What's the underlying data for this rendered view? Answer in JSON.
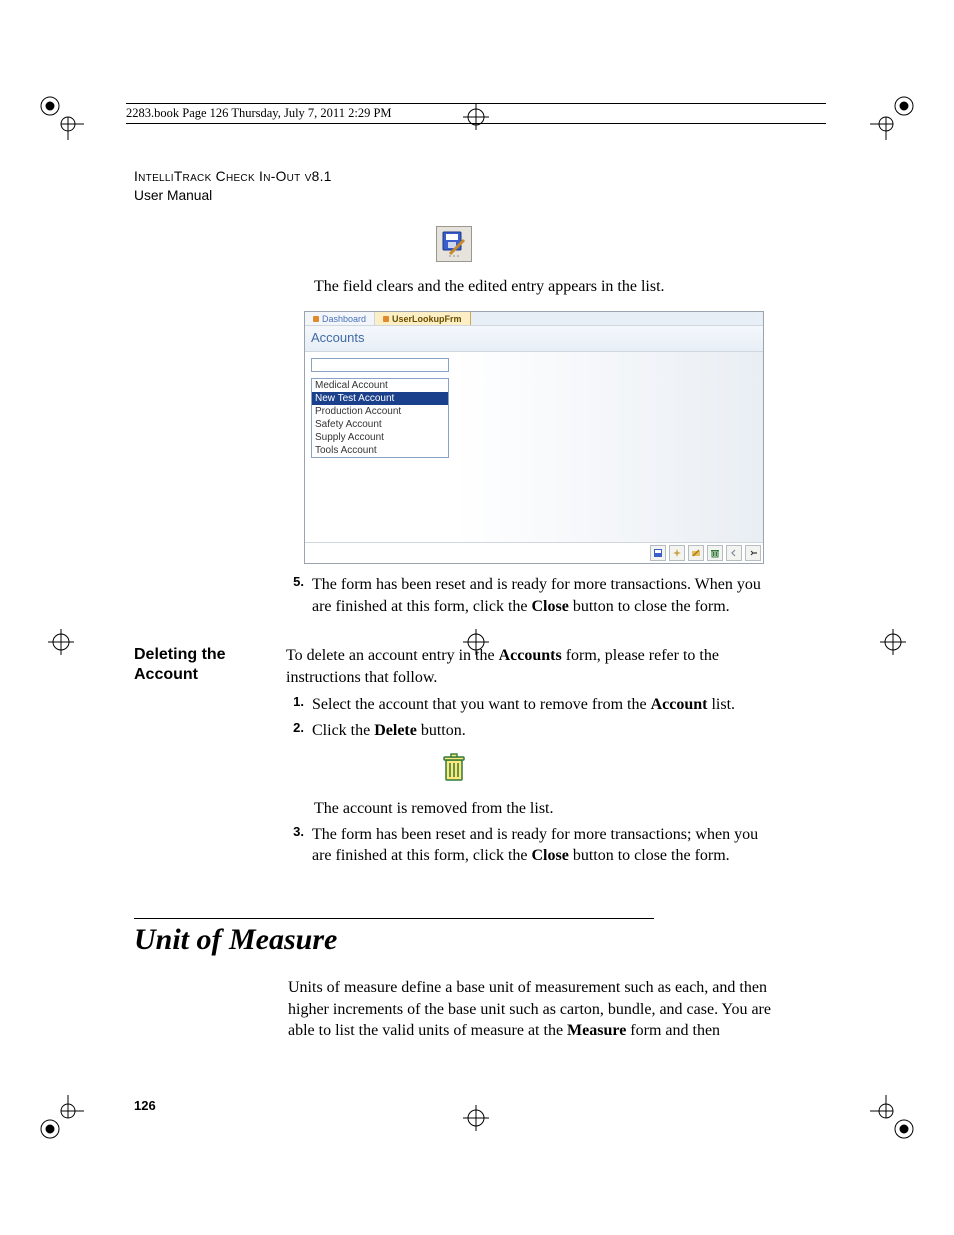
{
  "meta": {
    "header_bar": "2283.book  Page 126  Thursday, July 7, 2011  2:29 PM",
    "product_line": "IntelliTrack Check In-Out v8.1",
    "subtitle": "User Manual",
    "page_number": "126"
  },
  "body1": {
    "line": "The field clears and the edited entry appears in the list."
  },
  "screenshot": {
    "tabs": {
      "inactive": "Dashboard",
      "active": "UserLookupFrm"
    },
    "title": "Accounts",
    "input_value": "",
    "list": [
      "Medical Account",
      "New Test Account",
      "Production Account",
      "Safety Account",
      "Supply Account",
      "Tools Account"
    ],
    "selected_index": 1,
    "toolbar_icons": [
      "disk-pencil-icon",
      "sparkle-icon",
      "folder-pencil-icon",
      "trash-icon",
      "back-icon",
      "close-icon"
    ]
  },
  "step5": {
    "num": "5.",
    "text_a": "The form has been reset and is ready for more transactions. When you are finished at this form, click the ",
    "bold": "Close",
    "text_b": " button to close the form."
  },
  "deleting": {
    "heading": "Deleting the Account",
    "intro_a": "To delete an account entry in the ",
    "intro_bold": "Accounts",
    "intro_b": " form, please refer to the instructions that follow.",
    "s1": {
      "num": "1.",
      "a": "Select the account that you want to remove from the ",
      "bold": "Account",
      "b": " list."
    },
    "s2": {
      "num": "2.",
      "a": "Click the ",
      "bold": "Delete",
      "b": " button."
    },
    "after_icon": "The account is removed from the list.",
    "s3": {
      "num": "3.",
      "a": "The form has been reset and is ready for more transactions; when you are finished at this form, click the ",
      "bold": "Close",
      "b": " button to close the form."
    }
  },
  "section": {
    "title": "Unit of Measure",
    "para_a": "Units of measure define a base unit of measurement such as each, and then higher increments of the base unit such as carton, bundle, and case. You are able to list the valid units of measure at the ",
    "para_bold": "Measure",
    "para_b": " form and then"
  }
}
